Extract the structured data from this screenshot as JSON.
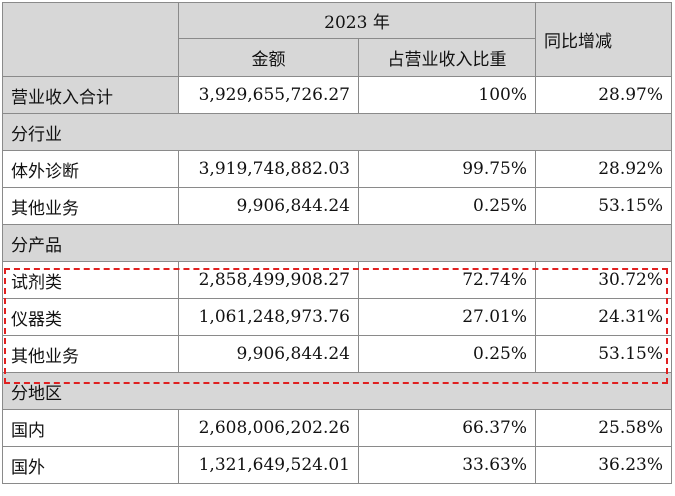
{
  "header": {
    "year_label": "2023 年",
    "amount_label": "金额",
    "ratio_label": "占营业收入比重",
    "yoy_label": "同比增减"
  },
  "total": {
    "label": "营业收入合计",
    "amount": "3,929,655,726.27",
    "ratio": "100%",
    "yoy": "28.97%"
  },
  "sections": [
    {
      "title": "分行业",
      "rows": [
        {
          "label": "体外诊断",
          "amount": "3,919,748,882.03",
          "ratio": "99.75%",
          "yoy": "28.92%"
        },
        {
          "label": "其他业务",
          "amount": "9,906,844.24",
          "ratio": "0.25%",
          "yoy": "53.15%"
        }
      ]
    },
    {
      "title": "分产品",
      "rows": [
        {
          "label": "试剂类",
          "amount": "2,858,499,908.27",
          "ratio": "72.74%",
          "yoy": "30.72%"
        },
        {
          "label": "仪器类",
          "amount": "1,061,248,973.76",
          "ratio": "27.01%",
          "yoy": "24.31%"
        },
        {
          "label": "其他业务",
          "amount": "9,906,844.24",
          "ratio": "0.25%",
          "yoy": "53.15%"
        }
      ]
    },
    {
      "title": "分地区",
      "rows": [
        {
          "label": "国内",
          "amount": "2,608,006,202.26",
          "ratio": "66.37%",
          "yoy": "25.58%"
        },
        {
          "label": "国外",
          "amount": "1,321,649,524.01",
          "ratio": "33.63%",
          "yoy": "36.23%"
        }
      ]
    }
  ],
  "highlight": {
    "color": "#e02020",
    "section": "分产品"
  }
}
